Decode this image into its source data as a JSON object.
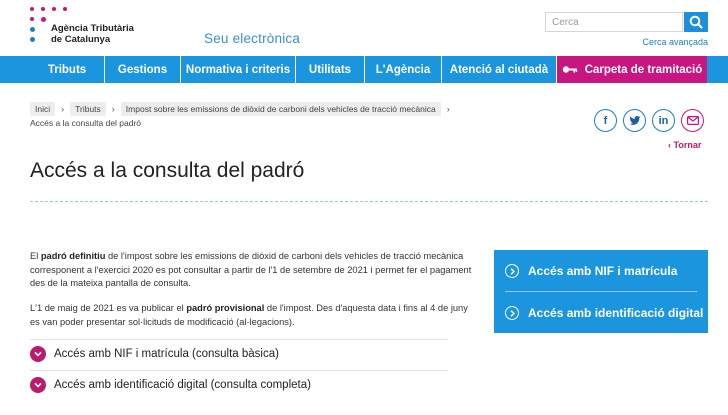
{
  "header": {
    "logo_line1": "Agència Tributària",
    "logo_line2": "de Catalunya",
    "site_name": "Seu  electrònica",
    "search_placeholder": "Cerca",
    "advanced_search": "Cerca avançada"
  },
  "nav": {
    "items": [
      {
        "label": "Tributs"
      },
      {
        "label": "Gestions"
      },
      {
        "label": "Normativa i criteris"
      },
      {
        "label": "Utilitats"
      },
      {
        "label": "L'Agència"
      },
      {
        "label": "Atenció al ciutadà"
      },
      {
        "label": "Carpeta de tramitació"
      }
    ]
  },
  "breadcrumb": {
    "items": [
      {
        "label": "Inici"
      },
      {
        "label": "Tributs"
      },
      {
        "label": "Impost sobre les emissions de diòxid de carboni dels vehicles de tracció mecànica"
      }
    ],
    "current": "Accés a la consulta del padró"
  },
  "share": {
    "facebook": "f",
    "twitter": "twitter",
    "linkedin": "in",
    "email": "email",
    "back": "Tornar"
  },
  "page": {
    "title": "Accés a la consulta del padró",
    "p1_pre": "El ",
    "p1_bold": "padró definitiu",
    "p1_post": " de l'impost sobre les emissions de diòxid de carboni dels vehicles de tracció mecànica corresponent a l'exercici 2020 es pot consultar a partir de l'1 de setembre de 2021 i permet fer el pagament des de la mateixa pantalla de consulta.",
    "p2_pre": "L'1 de maig de 2021 es va publicar el ",
    "p2_bold": "padró provisional",
    "p2_post": " de l'impost. Des d'aquesta data i fins al 4 de juny es van poder presentar sol·licituds de modificació (al·legacions)."
  },
  "accordion": {
    "items": [
      {
        "label": "Accés amb NIF i matrícula (consulta bàsica)"
      },
      {
        "label": "Accés amb identificació digital (consulta completa)"
      }
    ]
  },
  "access_box": {
    "items": [
      {
        "label": "Accés amb NIF i matrícula"
      },
      {
        "label": "Accés amb identificació digital"
      }
    ]
  },
  "colors": {
    "nav_blue": "#1b95de",
    "magenta": "#c8157f",
    "accent_dark_magenta": "#b81c6b"
  }
}
